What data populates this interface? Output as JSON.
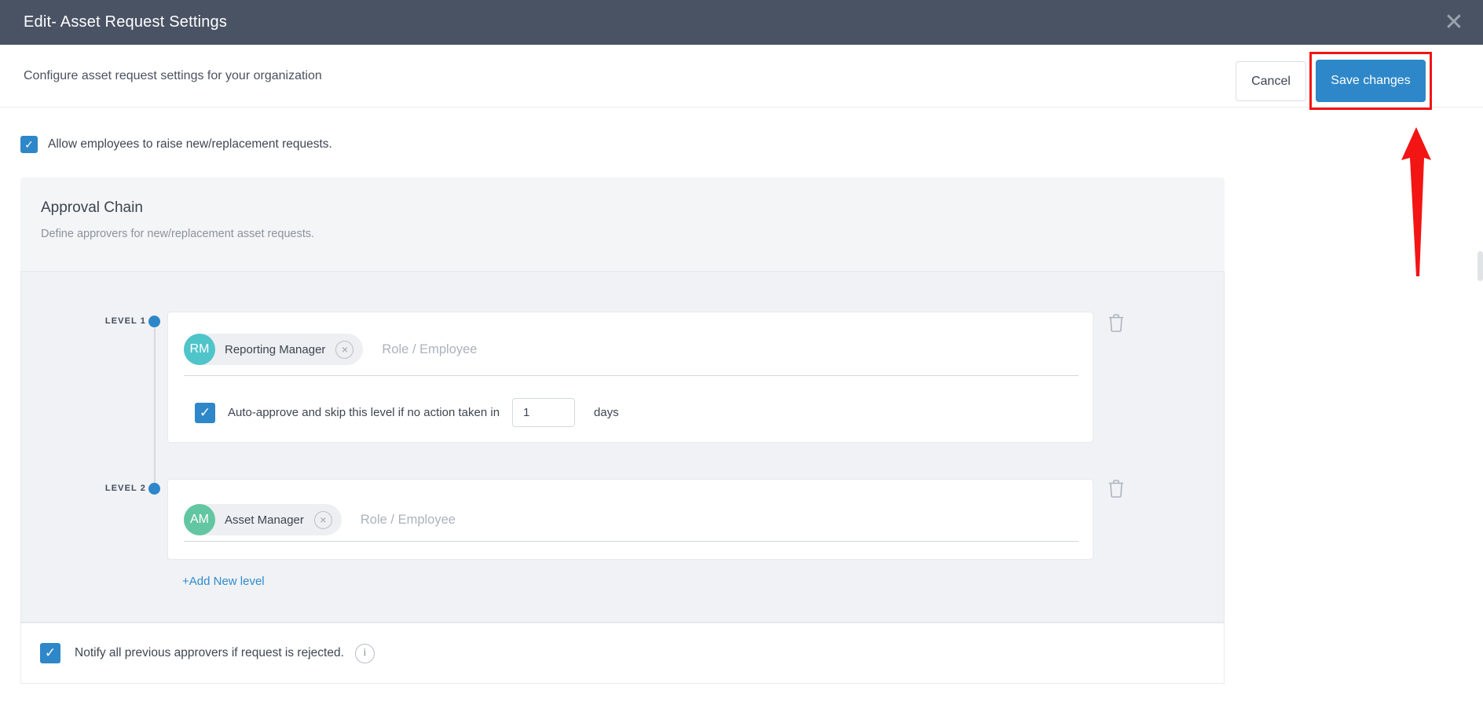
{
  "window": {
    "title": "Edit- Asset Request Settings",
    "close_icon": "✕"
  },
  "action_bar": {
    "subtitle": "Configure asset request settings for your organization",
    "cancel_label": "Cancel",
    "save_label": "Save changes"
  },
  "options": {
    "allow_requests_label": "Allow employees to raise new/replacement requests.",
    "allow_requests_checked": true,
    "notify_label": "Notify all previous approvers if request is rejected.",
    "notify_checked": true
  },
  "approval_chain": {
    "title": "Approval Chain",
    "subtitle": "Define approvers for new/replacement asset requests.",
    "role_placeholder": "Role / Employee",
    "add_level_label": "+Add New level",
    "levels": [
      {
        "label": "LEVEL 1",
        "approver_initials": "RM",
        "approver_name": "Reporting Manager",
        "auto_approve_label": "Auto-approve and skip this level if no action taken in",
        "auto_approve_days": "1",
        "auto_approve_unit": "days",
        "auto_approve_checked": true
      },
      {
        "label": "LEVEL 2",
        "approver_initials": "AM",
        "approver_name": "Asset Manager"
      }
    ]
  },
  "icons": {
    "check": "✓",
    "remove": "×",
    "info": "i"
  },
  "colors": {
    "header_bg": "#4a5364",
    "primary_blue": "#2e87c8",
    "link_blue": "#2e8bcc",
    "avatar_rm": "#4fc4c9",
    "avatar_am": "#63c6a2",
    "annotation_red": "#f31414",
    "panel_bg": "#f4f5f7"
  }
}
